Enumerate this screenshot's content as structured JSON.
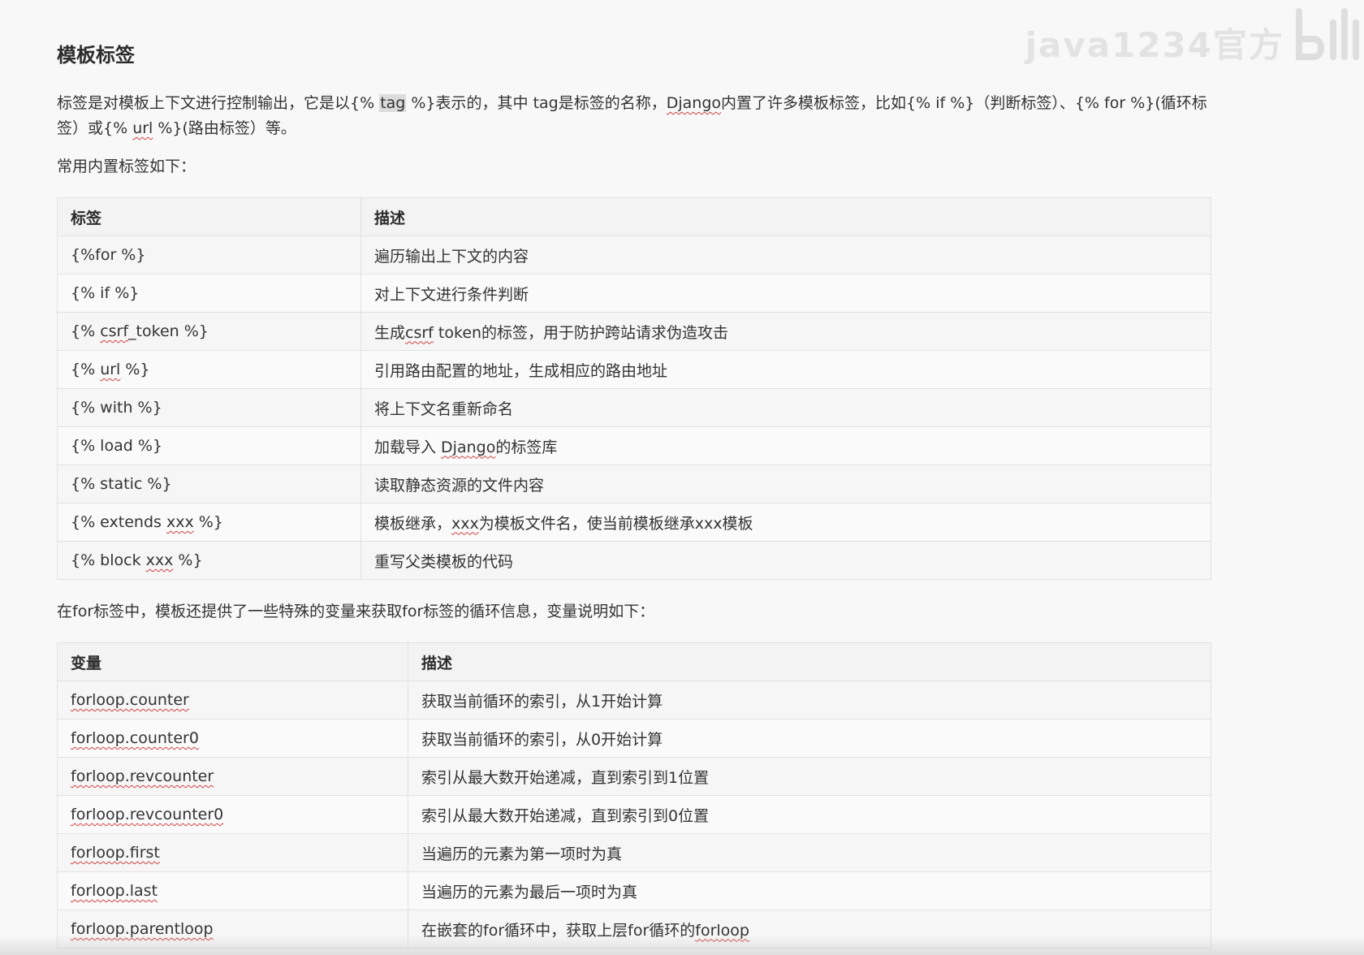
{
  "watermark": {
    "text": "java1234官方"
  },
  "heading": "模板标签",
  "intro": {
    "p1": "标签是对模板上下文进行控制输出，它是以{% ",
    "tag": "tag",
    "p2": " %}表示的，其中 tag是标签的名称，",
    "django": "Django",
    "p3": "内置了许多模板标签，比如{% if %}（判断标签）、{% for %}(循环标签）或{% ",
    "url": "url",
    "p4": " %}(路由标签）等。"
  },
  "table1_caption": "常用内置标签如下：",
  "table1": {
    "headers": [
      "标签",
      "描述"
    ],
    "rows": [
      {
        "pre": "{%for %}",
        "sq": "",
        "post": "",
        "desc_pre": "遍历输出上下文的内容",
        "desc_sq": "",
        "desc_post": ""
      },
      {
        "pre": "{% if %}",
        "sq": "",
        "post": "",
        "desc_pre": "对上下文进行条件判断",
        "desc_sq": "",
        "desc_post": ""
      },
      {
        "pre": "{% ",
        "sq": "csrf",
        "post": "_token %}",
        "desc_pre": "生成",
        "desc_sq": "csrf",
        "desc_post": " token的标签，用于防护跨站请求伪造攻击"
      },
      {
        "pre": "{% ",
        "sq": "url",
        "post": " %}",
        "desc_pre": "引用路由配置的地址，生成相应的路由地址",
        "desc_sq": "",
        "desc_post": ""
      },
      {
        "pre": "{% with %}",
        "sq": "",
        "post": "",
        "desc_pre": "将上下文名重新命名",
        "desc_sq": "",
        "desc_post": ""
      },
      {
        "pre": "{% load %}",
        "sq": "",
        "post": "",
        "desc_pre": "加载导入 ",
        "desc_sq": "Django",
        "desc_post": "的标签库"
      },
      {
        "pre": "{% static %}",
        "sq": "",
        "post": "",
        "desc_pre": "读取静态资源的文件内容",
        "desc_sq": "",
        "desc_post": ""
      },
      {
        "pre": "{% extends ",
        "sq": "xxx",
        "post": " %}",
        "desc_pre": "模板继承，",
        "desc_sq": "xxx",
        "desc_post": "为模板文件名，使当前模板继承xxx模板"
      },
      {
        "pre": "{% block ",
        "sq": "xxx",
        "post": " %}",
        "desc_pre": "重写父类模板的代码",
        "desc_sq": "",
        "desc_post": ""
      }
    ]
  },
  "table2_caption": "在for标签中，模板还提供了一些特殊的变量来获取for标签的循环信息，变量说明如下：",
  "table2": {
    "headers": [
      "变量",
      "描述"
    ],
    "rows": [
      {
        "var": "forloop.counter",
        "desc_pre": "获取当前循环的索引，从1开始计算",
        "desc_sq": "",
        "desc_post": ""
      },
      {
        "var": "forloop.counter0",
        "desc_pre": "获取当前循环的索引，从0开始计算",
        "desc_sq": "",
        "desc_post": ""
      },
      {
        "var": "forloop.revcounter",
        "desc_pre": "索引从最大数开始递减，直到索引到1位置",
        "desc_sq": "",
        "desc_post": ""
      },
      {
        "var": "forloop.revcounter0",
        "desc_pre": "索引从最大数开始递减，直到索引到0位置",
        "desc_sq": "",
        "desc_post": ""
      },
      {
        "var": "forloop.first",
        "desc_pre": "当遍历的元素为第一项时为真",
        "desc_sq": "",
        "desc_post": ""
      },
      {
        "var": "forloop.last",
        "desc_pre": "当遍历的元素为最后一项时为真",
        "desc_sq": "",
        "desc_post": ""
      },
      {
        "var": "forloop.parentloop",
        "desc_pre": "在嵌套的for循环中，获取上层for循环的",
        "desc_sq": "forloop",
        "desc_post": ""
      }
    ]
  }
}
